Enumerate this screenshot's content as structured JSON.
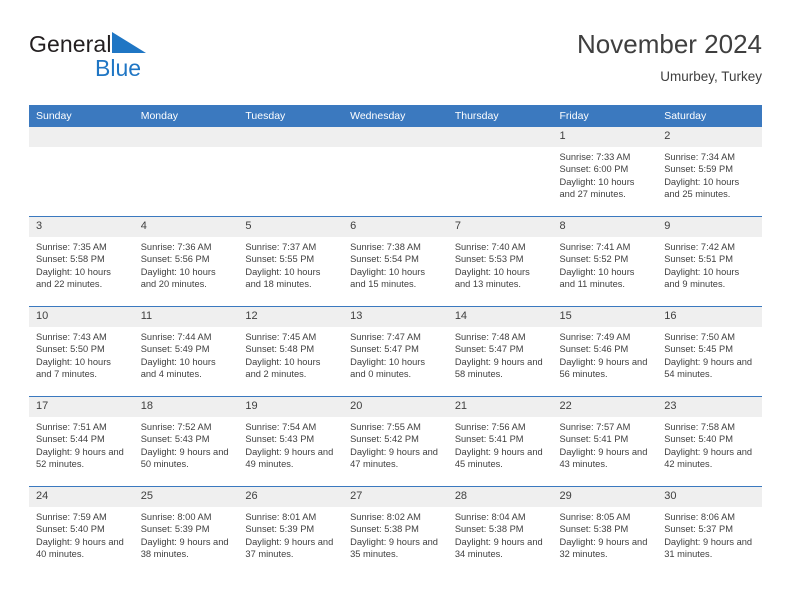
{
  "brand": {
    "name_dark": "General",
    "name_blue": "Blue",
    "triangle_color": "#1f76c4",
    "text_color": "#231f20"
  },
  "header": {
    "title": "November 2024",
    "subtitle": "Umurbey, Turkey"
  },
  "colors": {
    "header_blue": "#3b79bf",
    "daynum_gray": "#efefef",
    "text": "#3f3f3f"
  },
  "weekdays": [
    "Sunday",
    "Monday",
    "Tuesday",
    "Wednesday",
    "Thursday",
    "Friday",
    "Saturday"
  ],
  "labels": {
    "sunrise": "Sunrise:",
    "sunset": "Sunset:",
    "daylight": "Daylight:"
  },
  "weeks": [
    [
      {
        "day": "",
        "sunrise": "",
        "sunset": "",
        "daylight": ""
      },
      {
        "day": "",
        "sunrise": "",
        "sunset": "",
        "daylight": ""
      },
      {
        "day": "",
        "sunrise": "",
        "sunset": "",
        "daylight": ""
      },
      {
        "day": "",
        "sunrise": "",
        "sunset": "",
        "daylight": ""
      },
      {
        "day": "",
        "sunrise": "",
        "sunset": "",
        "daylight": ""
      },
      {
        "day": "1",
        "sunrise": "Sunrise: 7:33 AM",
        "sunset": "Sunset: 6:00 PM",
        "daylight": "Daylight: 10 hours and 27 minutes."
      },
      {
        "day": "2",
        "sunrise": "Sunrise: 7:34 AM",
        "sunset": "Sunset: 5:59 PM",
        "daylight": "Daylight: 10 hours and 25 minutes."
      }
    ],
    [
      {
        "day": "3",
        "sunrise": "Sunrise: 7:35 AM",
        "sunset": "Sunset: 5:58 PM",
        "daylight": "Daylight: 10 hours and 22 minutes."
      },
      {
        "day": "4",
        "sunrise": "Sunrise: 7:36 AM",
        "sunset": "Sunset: 5:56 PM",
        "daylight": "Daylight: 10 hours and 20 minutes."
      },
      {
        "day": "5",
        "sunrise": "Sunrise: 7:37 AM",
        "sunset": "Sunset: 5:55 PM",
        "daylight": "Daylight: 10 hours and 18 minutes."
      },
      {
        "day": "6",
        "sunrise": "Sunrise: 7:38 AM",
        "sunset": "Sunset: 5:54 PM",
        "daylight": "Daylight: 10 hours and 15 minutes."
      },
      {
        "day": "7",
        "sunrise": "Sunrise: 7:40 AM",
        "sunset": "Sunset: 5:53 PM",
        "daylight": "Daylight: 10 hours and 13 minutes."
      },
      {
        "day": "8",
        "sunrise": "Sunrise: 7:41 AM",
        "sunset": "Sunset: 5:52 PM",
        "daylight": "Daylight: 10 hours and 11 minutes."
      },
      {
        "day": "9",
        "sunrise": "Sunrise: 7:42 AM",
        "sunset": "Sunset: 5:51 PM",
        "daylight": "Daylight: 10 hours and 9 minutes."
      }
    ],
    [
      {
        "day": "10",
        "sunrise": "Sunrise: 7:43 AM",
        "sunset": "Sunset: 5:50 PM",
        "daylight": "Daylight: 10 hours and 7 minutes."
      },
      {
        "day": "11",
        "sunrise": "Sunrise: 7:44 AM",
        "sunset": "Sunset: 5:49 PM",
        "daylight": "Daylight: 10 hours and 4 minutes."
      },
      {
        "day": "12",
        "sunrise": "Sunrise: 7:45 AM",
        "sunset": "Sunset: 5:48 PM",
        "daylight": "Daylight: 10 hours and 2 minutes."
      },
      {
        "day": "13",
        "sunrise": "Sunrise: 7:47 AM",
        "sunset": "Sunset: 5:47 PM",
        "daylight": "Daylight: 10 hours and 0 minutes."
      },
      {
        "day": "14",
        "sunrise": "Sunrise: 7:48 AM",
        "sunset": "Sunset: 5:47 PM",
        "daylight": "Daylight: 9 hours and 58 minutes."
      },
      {
        "day": "15",
        "sunrise": "Sunrise: 7:49 AM",
        "sunset": "Sunset: 5:46 PM",
        "daylight": "Daylight: 9 hours and 56 minutes."
      },
      {
        "day": "16",
        "sunrise": "Sunrise: 7:50 AM",
        "sunset": "Sunset: 5:45 PM",
        "daylight": "Daylight: 9 hours and 54 minutes."
      }
    ],
    [
      {
        "day": "17",
        "sunrise": "Sunrise: 7:51 AM",
        "sunset": "Sunset: 5:44 PM",
        "daylight": "Daylight: 9 hours and 52 minutes."
      },
      {
        "day": "18",
        "sunrise": "Sunrise: 7:52 AM",
        "sunset": "Sunset: 5:43 PM",
        "daylight": "Daylight: 9 hours and 50 minutes."
      },
      {
        "day": "19",
        "sunrise": "Sunrise: 7:54 AM",
        "sunset": "Sunset: 5:43 PM",
        "daylight": "Daylight: 9 hours and 49 minutes."
      },
      {
        "day": "20",
        "sunrise": "Sunrise: 7:55 AM",
        "sunset": "Sunset: 5:42 PM",
        "daylight": "Daylight: 9 hours and 47 minutes."
      },
      {
        "day": "21",
        "sunrise": "Sunrise: 7:56 AM",
        "sunset": "Sunset: 5:41 PM",
        "daylight": "Daylight: 9 hours and 45 minutes."
      },
      {
        "day": "22",
        "sunrise": "Sunrise: 7:57 AM",
        "sunset": "Sunset: 5:41 PM",
        "daylight": "Daylight: 9 hours and 43 minutes."
      },
      {
        "day": "23",
        "sunrise": "Sunrise: 7:58 AM",
        "sunset": "Sunset: 5:40 PM",
        "daylight": "Daylight: 9 hours and 42 minutes."
      }
    ],
    [
      {
        "day": "24",
        "sunrise": "Sunrise: 7:59 AM",
        "sunset": "Sunset: 5:40 PM",
        "daylight": "Daylight: 9 hours and 40 minutes."
      },
      {
        "day": "25",
        "sunrise": "Sunrise: 8:00 AM",
        "sunset": "Sunset: 5:39 PM",
        "daylight": "Daylight: 9 hours and 38 minutes."
      },
      {
        "day": "26",
        "sunrise": "Sunrise: 8:01 AM",
        "sunset": "Sunset: 5:39 PM",
        "daylight": "Daylight: 9 hours and 37 minutes."
      },
      {
        "day": "27",
        "sunrise": "Sunrise: 8:02 AM",
        "sunset": "Sunset: 5:38 PM",
        "daylight": "Daylight: 9 hours and 35 minutes."
      },
      {
        "day": "28",
        "sunrise": "Sunrise: 8:04 AM",
        "sunset": "Sunset: 5:38 PM",
        "daylight": "Daylight: 9 hours and 34 minutes."
      },
      {
        "day": "29",
        "sunrise": "Sunrise: 8:05 AM",
        "sunset": "Sunset: 5:38 PM",
        "daylight": "Daylight: 9 hours and 32 minutes."
      },
      {
        "day": "30",
        "sunrise": "Sunrise: 8:06 AM",
        "sunset": "Sunset: 5:37 PM",
        "daylight": "Daylight: 9 hours and 31 minutes."
      }
    ]
  ]
}
